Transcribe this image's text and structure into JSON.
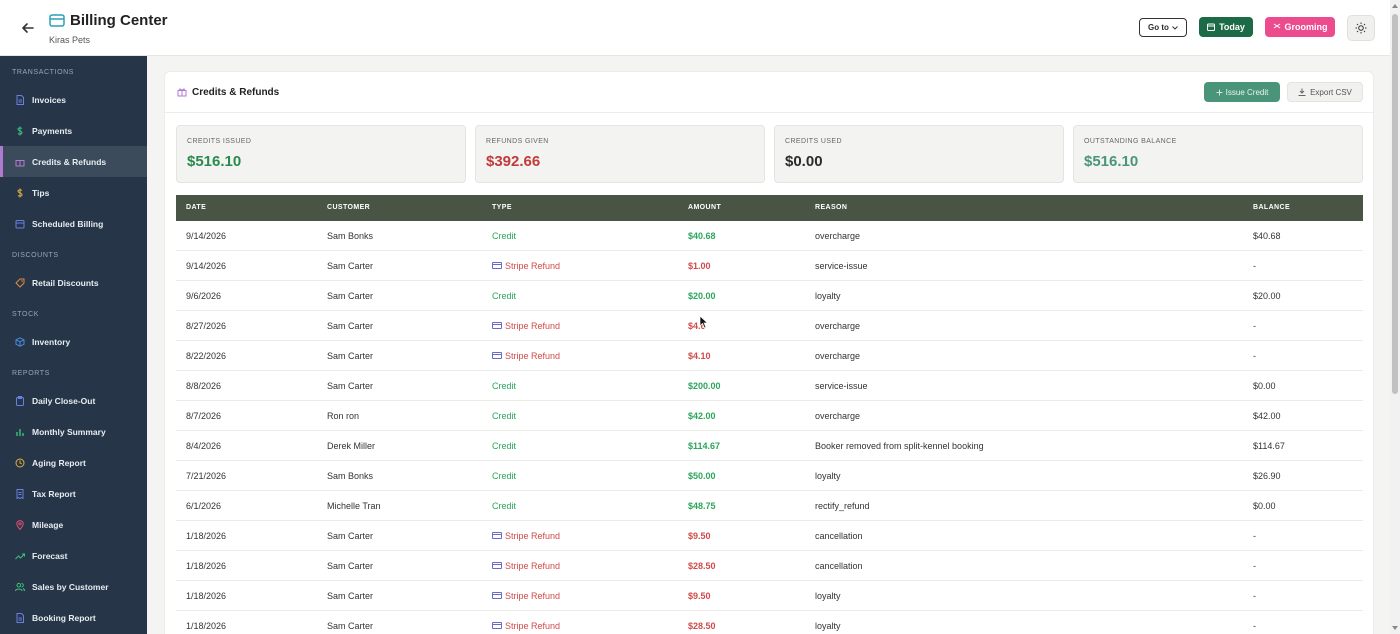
{
  "header": {
    "title": "Billing Center",
    "subtitle": "Kiras Pets",
    "goto_label": "Go to",
    "today_label": "Today",
    "grooming_label": "Grooming"
  },
  "sidebar": {
    "sections": [
      {
        "label": "TRANSACTIONS",
        "items": [
          {
            "label": "Invoices",
            "icon": "document-icon",
            "color": "#6b7fe0"
          },
          {
            "label": "Payments",
            "icon": "dollar-icon",
            "color": "#3cc27a"
          },
          {
            "label": "Credits & Refunds",
            "icon": "gift-icon",
            "color": "#b07ad0",
            "active": true
          },
          {
            "label": "Tips",
            "icon": "dollar-icon",
            "color": "#e0b040"
          },
          {
            "label": "Scheduled Billing",
            "icon": "calendar-icon",
            "color": "#6b7fe0"
          }
        ]
      },
      {
        "label": "DISCOUNTS",
        "items": [
          {
            "label": "Retail Discounts",
            "icon": "tag-icon",
            "color": "#e08a40"
          }
        ]
      },
      {
        "label": "STOCK",
        "items": [
          {
            "label": "Inventory",
            "icon": "box-icon",
            "color": "#4a8ae0"
          }
        ]
      },
      {
        "label": "REPORTS",
        "items": [
          {
            "label": "Daily Close-Out",
            "icon": "clipboard-icon",
            "color": "#6b7fe0"
          },
          {
            "label": "Monthly Summary",
            "icon": "bar-chart-icon",
            "color": "#3cc27a"
          },
          {
            "label": "Aging Report",
            "icon": "clock-icon",
            "color": "#e0b040"
          },
          {
            "label": "Tax Report",
            "icon": "receipt-icon",
            "color": "#6b7fe0"
          },
          {
            "label": "Mileage",
            "icon": "map-pin-icon",
            "color": "#e05070"
          },
          {
            "label": "Forecast",
            "icon": "trend-icon",
            "color": "#3cc27a"
          },
          {
            "label": "Sales by Customer",
            "icon": "users-icon",
            "color": "#3cc27a"
          },
          {
            "label": "Booking Report",
            "icon": "document-icon",
            "color": "#6b7fe0"
          }
        ]
      }
    ]
  },
  "card": {
    "title": "Credits & Refunds",
    "issue_credit_label": "Issue Credit",
    "export_label": "Export CSV"
  },
  "stats": [
    {
      "label": "CREDITS ISSUED",
      "value": "$516.10",
      "color": "#2a8a4e"
    },
    {
      "label": "REFUNDS GIVEN",
      "value": "$392.66",
      "color": "#c23a3a"
    },
    {
      "label": "CREDITS USED",
      "value": "$0.00",
      "color": "#2b2b2b"
    },
    {
      "label": "OUTSTANDING BALANCE",
      "value": "$516.10",
      "color": "#4a957a"
    }
  ],
  "table": {
    "columns": [
      "DATE",
      "CUSTOMER",
      "TYPE",
      "AMOUNT",
      "REASON",
      "BALANCE"
    ],
    "rows": [
      {
        "date": "9/14/2026",
        "customer": "Sam Bonks",
        "type": "Credit",
        "amount": "$40.68",
        "reason": "overcharge",
        "balance": "$40.68"
      },
      {
        "date": "9/14/2026",
        "customer": "Sam Carter",
        "type": "Stripe Refund",
        "amount": "$1.00",
        "reason": "service-issue",
        "balance": "-"
      },
      {
        "date": "9/6/2026",
        "customer": "Sam Carter",
        "type": "Credit",
        "amount": "$20.00",
        "reason": "loyalty",
        "balance": "$20.00"
      },
      {
        "date": "8/27/2026",
        "customer": "Sam Carter",
        "type": "Stripe Refund",
        "amount": "$4.6",
        "reason": "overcharge",
        "balance": "-"
      },
      {
        "date": "8/22/2026",
        "customer": "Sam Carter",
        "type": "Stripe Refund",
        "amount": "$4.10",
        "reason": "overcharge",
        "balance": "-"
      },
      {
        "date": "8/8/2026",
        "customer": "Sam Carter",
        "type": "Credit",
        "amount": "$200.00",
        "reason": "service-issue",
        "balance": "$0.00"
      },
      {
        "date": "8/7/2026",
        "customer": "Ron ron",
        "type": "Credit",
        "amount": "$42.00",
        "reason": "overcharge",
        "balance": "$42.00"
      },
      {
        "date": "8/4/2026",
        "customer": "Derek Miller",
        "type": "Credit",
        "amount": "$114.67",
        "reason": "Booker removed from split-kennel booking",
        "balance": "$114.67"
      },
      {
        "date": "7/21/2026",
        "customer": "Sam Bonks",
        "type": "Credit",
        "amount": "$50.00",
        "reason": "loyalty",
        "balance": "$26.90"
      },
      {
        "date": "6/1/2026",
        "customer": "Michelle Tran",
        "type": "Credit",
        "amount": "$48.75",
        "reason": "rectify_refund",
        "balance": "$0.00"
      },
      {
        "date": "1/18/2026",
        "customer": "Sam Carter",
        "type": "Stripe Refund",
        "amount": "$9.50",
        "reason": "cancellation",
        "balance": "-"
      },
      {
        "date": "1/18/2026",
        "customer": "Sam Carter",
        "type": "Stripe Refund",
        "amount": "$28.50",
        "reason": "cancellation",
        "balance": "-"
      },
      {
        "date": "1/18/2026",
        "customer": "Sam Carter",
        "type": "Stripe Refund",
        "amount": "$9.50",
        "reason": "loyalty",
        "balance": "-"
      },
      {
        "date": "1/18/2026",
        "customer": "Sam Carter",
        "type": "Stripe Refund",
        "amount": "$28.50",
        "reason": "loyalty",
        "balance": "-"
      }
    ]
  },
  "colors": {
    "sidebar_bg": "#263648",
    "table_header_bg": "#485544",
    "today_green": "#1c6b46",
    "grooming_pink": "#ec4b8e",
    "credit_green": "#2aa65a",
    "refund_red": "#d04a4a"
  }
}
